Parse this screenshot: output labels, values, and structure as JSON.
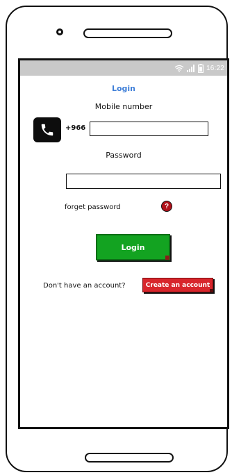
{
  "status_bar": {
    "time": "16:22"
  },
  "screen": {
    "title": "Login",
    "mobile_label": "Mobile number",
    "country_code": "+966",
    "mobile_value": "",
    "password_label": "Password",
    "password_value": "",
    "forget_password": "forget password",
    "help_glyph": "?",
    "login_button": "Login",
    "no_account_text": "Don't have an account?",
    "create_account_button": "Create an account"
  },
  "colors": {
    "accent_title": "#3f7fd8",
    "login_green": "#13a321",
    "create_red": "#d8262c",
    "status_gray": "#c9c9c9"
  },
  "icons": [
    "phone-icon",
    "wifi-icon",
    "signal-icon",
    "battery-icon",
    "help-icon"
  ]
}
